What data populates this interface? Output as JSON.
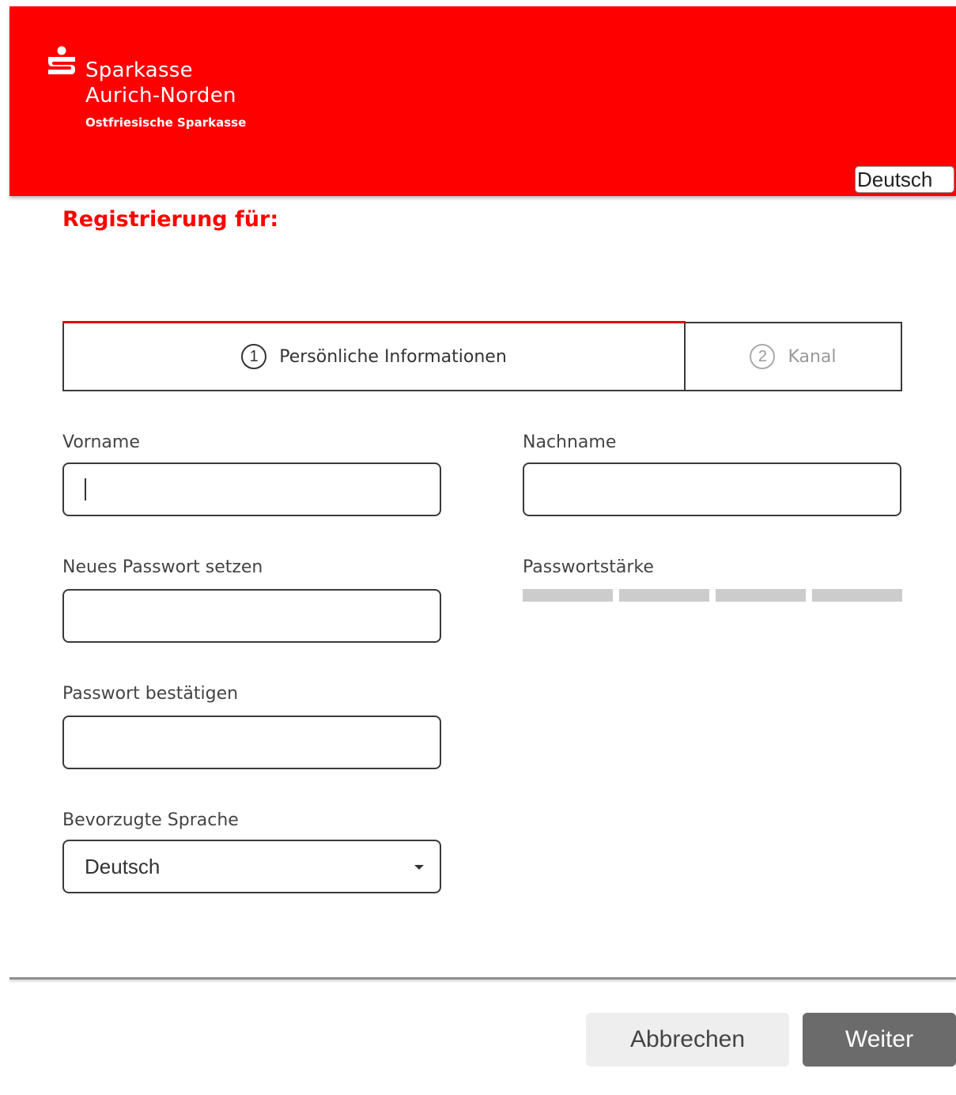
{
  "header": {
    "brand_line1": "Sparkasse",
    "brand_line2": "Aurich-Norden",
    "brand_sub": "Ostfriesische Sparkasse",
    "language_button": "Deutsch",
    "background_color": "#ff0000"
  },
  "page": {
    "title": "Registrierung für:"
  },
  "steps": [
    {
      "number": "1",
      "label": "Persönliche Informationen",
      "active": true
    },
    {
      "number": "2",
      "label": "Kanal",
      "active": false
    }
  ],
  "form": {
    "first_name": {
      "label": "Vorname",
      "value": ""
    },
    "last_name": {
      "label": "Nachname",
      "value": ""
    },
    "new_password": {
      "label": "Neues Passwort setzen",
      "value": ""
    },
    "password_strength": {
      "label": "Passwortstärke",
      "segments": 4,
      "filled": 0
    },
    "confirm_password": {
      "label": "Passwort bestätigen",
      "value": ""
    },
    "preferred_language": {
      "label": "Bevorzugte Sprache",
      "value": "Deutsch"
    }
  },
  "actions": {
    "cancel_label": "Abbrechen",
    "next_label": "Weiter"
  },
  "icons": {
    "logo": "sparkasse-s-logo",
    "dropdown": "caret-down"
  }
}
